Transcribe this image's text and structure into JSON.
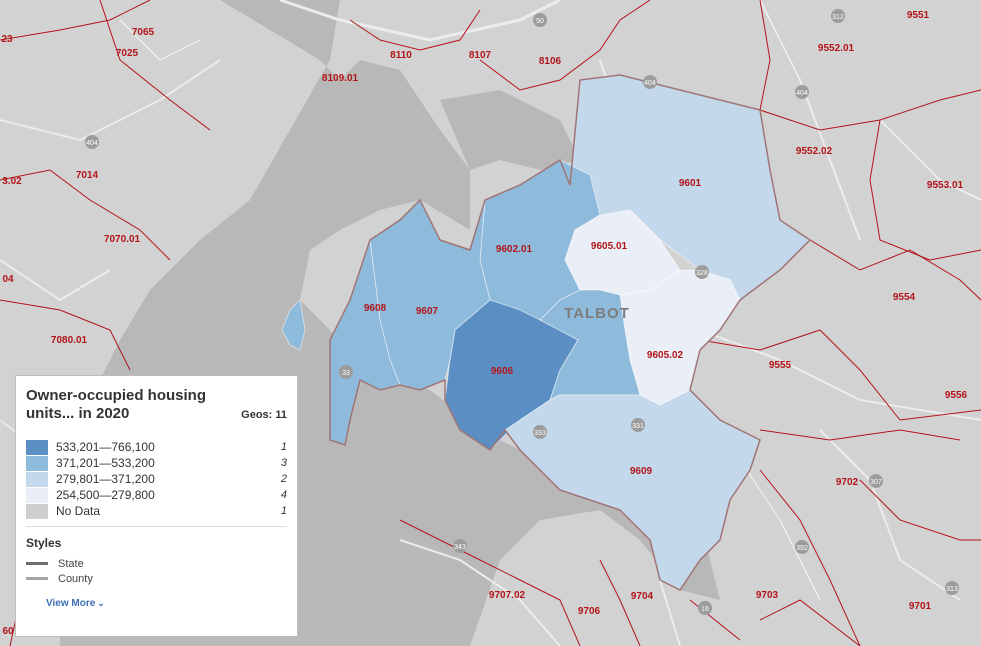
{
  "legend": {
    "title": "Owner-occupied housing units... in 2020",
    "geos_label": "Geos: 11",
    "classes": [
      {
        "range": "533,201—766,100",
        "count": "1",
        "color": "#5b8fc4"
      },
      {
        "range": "371,201—533,200",
        "count": "3",
        "color": "#8ebadb"
      },
      {
        "range": "279,801—371,200",
        "count": "2",
        "color": "#c3d8ea"
      },
      {
        "range": "254,500—279,800",
        "count": "4",
        "color": "#eaeff7"
      },
      {
        "range": "No Data",
        "count": "1",
        "color": "#cfcfcf"
      }
    ],
    "styles_title": "Styles",
    "styles": [
      {
        "label": "State"
      },
      {
        "label": "County"
      }
    ],
    "view_more": "View More"
  },
  "map": {
    "county_label": "TALBOT",
    "talbot_tracts": [
      "9601",
      "9602.01",
      "9605.01",
      "9605.02",
      "9606",
      "9607",
      "9608",
      "9609"
    ],
    "surrounding_tracts": [
      "7025",
      "7065",
      "7014",
      "7070.01",
      "7080.01",
      "8110",
      "8107",
      "8109.01",
      "8106",
      "9551",
      "9552.01",
      "9552.02",
      "9553.01",
      "9554",
      "9555",
      "9556",
      "9702",
      "9703",
      "9701",
      "9707.02",
      "9706",
      "9704"
    ],
    "edge_labels": [
      "23",
      "3.02",
      "04",
      "60"
    ],
    "road_shields": [
      "50",
      "312",
      "404",
      "404",
      "328",
      "333",
      "33",
      "307",
      "392",
      "313",
      "343",
      "16",
      "331",
      "404"
    ]
  }
}
